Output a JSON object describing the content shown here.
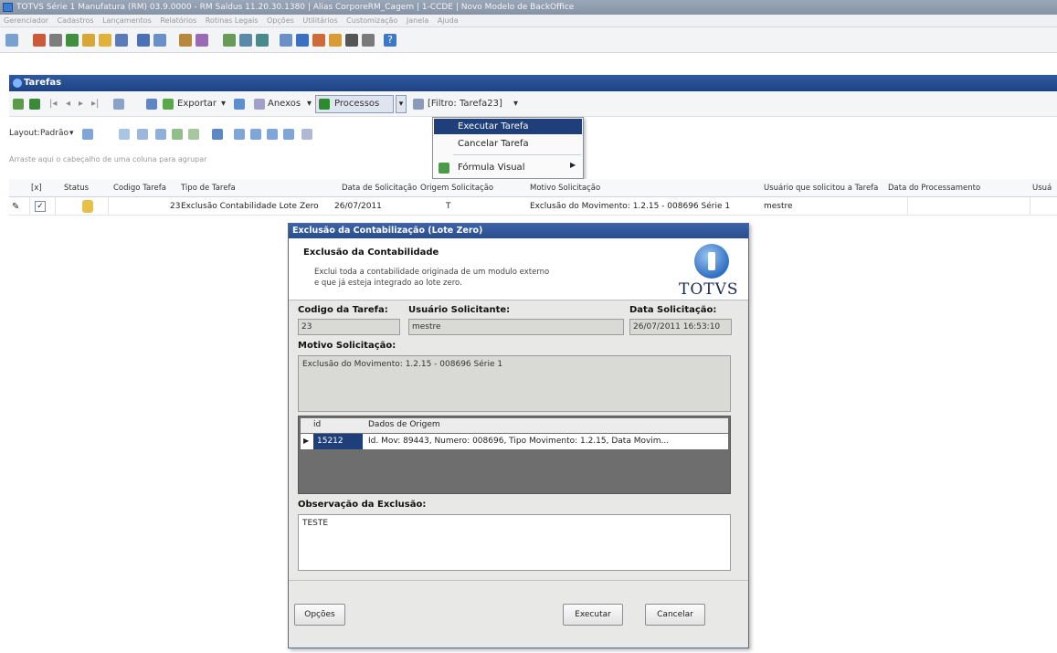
{
  "window": {
    "title": "TOTVS Série 1 Manufatura (RM) 03.9.0000 - RM Saldus 11.20.30.1380 | Alias CorporeRM_Cagem | 1-CCDE | Novo Modelo de BackOffice"
  },
  "menu": [
    "Gerenciador",
    "Cadastros",
    "Lançamentos",
    "Relatórios",
    "Rotinas Legais",
    "Opções",
    "Utilitários",
    "Customização",
    "Janela",
    "Ajuda"
  ],
  "panel": {
    "title": "Tarefas"
  },
  "grid_toolbar": {
    "exportar": "Exportar",
    "anexos": "Anexos",
    "processos": "Processos",
    "filtro": "[Filtro: Tarefa23]"
  },
  "processos_menu": {
    "items": [
      "Executar Tarefa",
      "Cancelar Tarefa",
      "Fórmula Visual"
    ]
  },
  "layout_row": {
    "layout_label": "Layout:",
    "layout_value": "Padrão"
  },
  "group_hint": "Arraste aqui o cabeçalho de uma coluna para agrupar",
  "grid": {
    "columns": [
      "[x]",
      "Status",
      "Codigo Tarefa",
      "Tipo de Tarefa",
      "Data de Solicitação",
      "Origem Solicitação",
      "Motivo Solicitação",
      "Usuário que solicitou a Tarefa",
      "Data do Processamento",
      "Usuá"
    ],
    "row": {
      "codigo": "23",
      "tipo": "Exclusão Contabilidade Lote Zero",
      "data": "26/07/2011",
      "origem": "T",
      "motivo": "Exclusão do Movimento: 1.2.15 - 008696 Série 1",
      "usuario": "mestre"
    }
  },
  "dialog": {
    "title": "Exclusão da Contabilização (Lote Zero)",
    "banner_title": "Exclusão da Contabilidade",
    "banner_desc_1": "Exclui toda a contabilidade originada de um modulo externo",
    "banner_desc_2": "e que já esteja integrado ao lote zero.",
    "brand": "TOTVS",
    "codigo_label": "Codigo da Tarefa:",
    "codigo_value": "23",
    "usuario_label": "Usuário Solicitante:",
    "usuario_value": "mestre",
    "data_label": "Data Solicitação:",
    "data_value": "26/07/2011 16:53:10",
    "motivo_label": "Motivo Solicitação:",
    "motivo_value": "Exclusão do Movimento: 1.2.15 - 008696 Série 1",
    "sub_grid": {
      "col_id": "id",
      "col_dados": "Dados de Origem",
      "row_id": "15212",
      "row_dados": "Id. Mov: 89443, Numero: 008696, Tipo Movimento: 1.2.15, Data Movim..."
    },
    "obs_label": "Observação da Exclusão:",
    "obs_value": "TESTE",
    "btn_opcoes": "Opções",
    "btn_executar": "Executar",
    "btn_cancelar": "Cancelar"
  },
  "colors": {
    "titlebar": "#8693a6",
    "panel_header": "#1e4384",
    "menu_active": "#1f3f7a",
    "subgrid_selected": "#1f3f7a"
  }
}
